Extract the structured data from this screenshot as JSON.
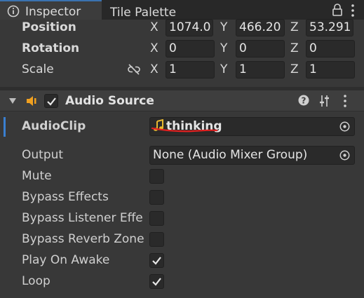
{
  "tabs": [
    {
      "label": "Inspector",
      "active": true,
      "icon": "info-icon"
    },
    {
      "label": "Tile Palette",
      "active": false
    }
  ],
  "tab_actions": {
    "lock_icon": "lock-icon",
    "menu_icon": "kebab-menu-icon"
  },
  "transform": {
    "position": {
      "label": "Position",
      "x": "1074.0",
      "y": "466.20",
      "z": "53.291"
    },
    "rotation": {
      "label": "Rotation",
      "x": "0",
      "y": "0",
      "z": "0"
    },
    "scale": {
      "label": "Scale",
      "x": "1",
      "y": "1",
      "z": "1",
      "link_icon": "constrain-proportions-icon"
    },
    "axis_labels": {
      "x": "X",
      "y": "Y",
      "z": "Z"
    }
  },
  "component": {
    "title": "Audio Source",
    "enabled": true,
    "icon": "speaker-icon",
    "header_icons": [
      "help-icon",
      "presets-icon",
      "context-menu-icon"
    ]
  },
  "properties": {
    "audio_clip": {
      "label": "AudioClip",
      "value": "thinking",
      "icon": "music-note-icon"
    },
    "output": {
      "label": "Output",
      "value": "None (Audio Mixer Group)"
    },
    "mute": {
      "label": "Mute",
      "checked": false
    },
    "bypass_effects": {
      "label": "Bypass Effects",
      "checked": false
    },
    "bypass_listener": {
      "label": "Bypass Listener Effe",
      "checked": false
    },
    "bypass_reverb": {
      "label": "Bypass Reverb Zone",
      "checked": false
    },
    "play_on_awake": {
      "label": "Play On Awake",
      "checked": true
    },
    "loop": {
      "label": "Loop",
      "checked": true
    }
  },
  "colors": {
    "panel_bg": "#383838",
    "field_bg": "#2a2a2a",
    "accent_blue": "#3a7fd0",
    "note_yellow": "#e8b830",
    "speaker_orange": "#f0a020",
    "annotation_red": "#e02020"
  }
}
